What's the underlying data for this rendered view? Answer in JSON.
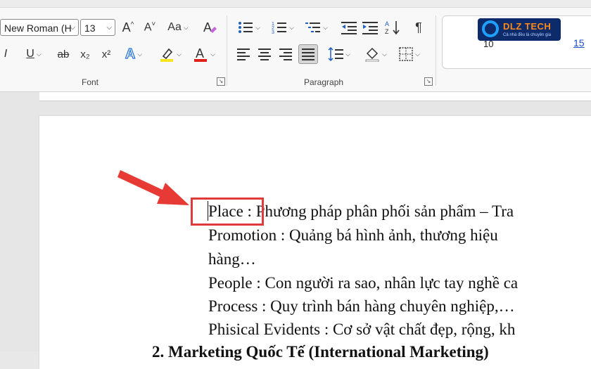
{
  "font": {
    "group_label": "Font",
    "font_name": "New Roman (H",
    "font_size": "13",
    "grow_icon": "A^",
    "shrink_icon": "A˅",
    "change_case": "Aa",
    "italic": "I",
    "underline": "U",
    "strikethrough": "ab",
    "subscript": "x₂",
    "superscript": "x²",
    "text_effects": "A",
    "font_color": "A"
  },
  "paragraph": {
    "group_label": "Paragraph",
    "show_marks": "¶"
  },
  "styles": {
    "num_left": "10",
    "num_right": "15"
  },
  "logo": {
    "brand": "DLZ TECH",
    "tagline": "Cả nhà đều là chuyên gia"
  },
  "document": {
    "lines": [
      "Place : Phương pháp phân phối sản phẩm – Tra",
      "Promotion : Quảng bá hình ảnh, thương hiệu",
      "hàng…",
      "People : Con người ra sao, nhân lực tay nghề ca",
      "Process : Quy trình bán hàng chuyên nghiệp,…",
      "Phisical Evidents : Cơ sở vật chất đẹp, rộng, kh"
    ],
    "heading": "2. Marketing Quốc Tế (International Marketing)"
  },
  "colors": {
    "highlight_yellow": "#f7e51f",
    "font_red": "#e0201b",
    "annotation_red": "#e03a3a"
  }
}
